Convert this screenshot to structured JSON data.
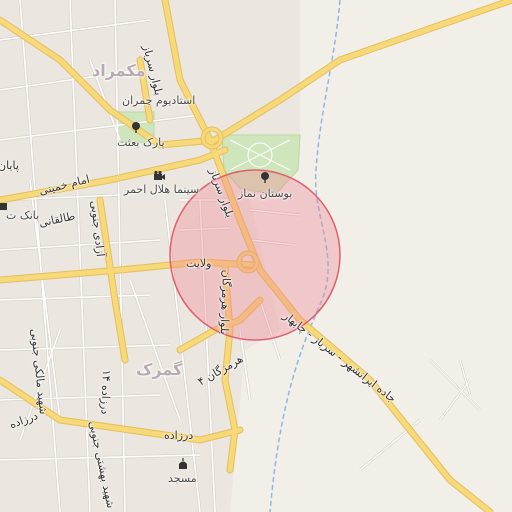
{
  "map": {
    "districts": {
      "north": "مکمراد",
      "south": "گمرک"
    },
    "places": {
      "stadium": "استادیوم چمران",
      "park_behesht": "پارک بعثت",
      "namaz_park": "بوستان نماز",
      "cinema": "سینما هلال احمر",
      "mosque": "مسجد",
      "bank": "بانک ت"
    },
    "roads": {
      "sarbaz_north": "بلوار سرباز",
      "sarbaz_center": "بلوار سرباز",
      "imam_khomeini": "امام خمینی",
      "taleghani": "طالقانی",
      "azadi_south": "آزادی جنوبی",
      "velayat": "ولایت",
      "hormozgan_blvd": "بلوار هرمزگان",
      "hormozgan_4": "هرمزگان ۴",
      "darzadeh": "درزاده",
      "darzadeh_14": "درزاده ۱۴",
      "malek_south": "شهید مالکی جنوبی",
      "beheshti_south": "شهید بهشتی جنوبی",
      "expressway": "جاده ایرانشهر - سرباز - چابهار",
      "edge_text": "پایان"
    },
    "colors": {
      "land": "#f2efe9",
      "road_major": "#f7d97a",
      "road_major_casing": "#e3bf5c",
      "road_minor": "#ffffff",
      "road_minor_casing": "#d8d2c8",
      "park": "#cfe6bd",
      "river": "#8db7e8",
      "highlight_fill": "#f08090",
      "highlight_stroke": "#e06070"
    }
  }
}
